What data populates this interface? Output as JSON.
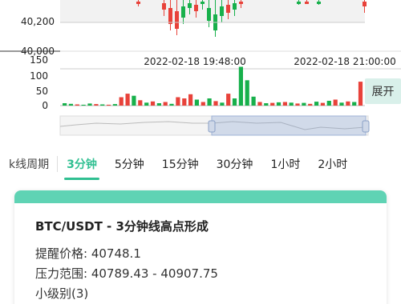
{
  "chart_data": {
    "type": "candlestick",
    "price_ticks": [
      "40,200",
      "40,000"
    ],
    "time_labels": [
      "2022-02-18 19:48:00",
      "2022-02-18 21:00:00"
    ],
    "volume_ticks": [
      "150",
      "100",
      "50",
      "0"
    ],
    "volume_ylim": [
      0,
      150
    ],
    "up_color": "#17b04b",
    "down_color": "#e8423a",
    "volume": [
      {
        "v": 8,
        "up": true
      },
      {
        "v": 6,
        "up": true
      },
      {
        "v": 4,
        "up": false
      },
      {
        "v": 3,
        "up": true
      },
      {
        "v": 7,
        "up": true
      },
      {
        "v": 5,
        "up": false
      },
      {
        "v": 4,
        "up": true
      },
      {
        "v": 3,
        "up": false
      },
      {
        "v": 5,
        "up": true
      },
      {
        "v": 28,
        "up": false
      },
      {
        "v": 40,
        "up": false
      },
      {
        "v": 33,
        "up": true
      },
      {
        "v": 18,
        "up": false
      },
      {
        "v": 10,
        "up": true
      },
      {
        "v": 14,
        "up": false
      },
      {
        "v": 8,
        "up": true
      },
      {
        "v": 12,
        "up": false
      },
      {
        "v": 6,
        "up": true
      },
      {
        "v": 28,
        "up": false
      },
      {
        "v": 24,
        "up": false
      },
      {
        "v": 38,
        "up": false
      },
      {
        "v": 20,
        "up": true
      },
      {
        "v": 12,
        "up": false
      },
      {
        "v": 24,
        "up": true
      },
      {
        "v": 15,
        "up": false
      },
      {
        "v": 10,
        "up": true
      },
      {
        "v": 40,
        "up": false
      },
      {
        "v": 24,
        "up": true
      },
      {
        "v": 130,
        "up": true
      },
      {
        "v": 85,
        "up": true
      },
      {
        "v": 30,
        "up": true
      },
      {
        "v": 12,
        "up": false
      },
      {
        "v": 8,
        "up": true
      },
      {
        "v": 9,
        "up": false
      },
      {
        "v": 11,
        "up": true
      },
      {
        "v": 12,
        "up": false
      },
      {
        "v": 10,
        "up": true
      },
      {
        "v": 7,
        "up": false
      },
      {
        "v": 9,
        "up": true
      },
      {
        "v": 6,
        "up": false
      },
      {
        "v": 13,
        "up": true
      },
      {
        "v": 9,
        "up": false
      },
      {
        "v": 16,
        "up": true
      },
      {
        "v": 20,
        "up": false
      },
      {
        "v": 10,
        "up": true
      },
      {
        "v": 14,
        "up": false
      },
      {
        "v": 12,
        "up": true
      },
      {
        "v": 80,
        "up": false
      }
    ]
  },
  "expand_label": "展开",
  "tabs": {
    "label": "k线周期",
    "items": [
      "3分钟",
      "5分钟",
      "15分钟",
      "30分钟",
      "1小时",
      "2小时"
    ],
    "active_index": 0
  },
  "alert": {
    "title": "BTC/USDT - 3分钟线高点形成",
    "price_label": "提醒价格:",
    "price_value": "40748.1",
    "range_label": "压力范围:",
    "range_value": "40789.43 - 40907.75",
    "level_label": "小级别(3)"
  },
  "colors": {
    "accent": "#2fbf91",
    "card_top": "#5fd3b4"
  }
}
